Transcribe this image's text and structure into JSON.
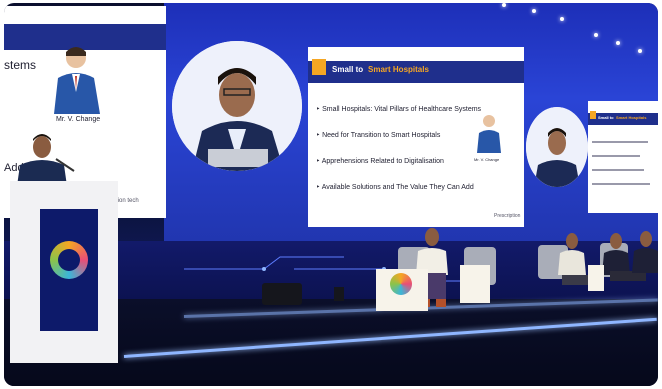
{
  "left_slide": {
    "partial_title": "stems",
    "partial_word": "Add",
    "caption": "Mr. V. Change",
    "footer_partial": "tion tech"
  },
  "main_slide": {
    "title_prefix": "Small to",
    "title_highlight": "Smart Hospitals",
    "bullets": [
      "Small Hospitals: Vital Pillars of Healthcare Systems",
      "Need for Transition to Smart Hospitals",
      "Apprehensions Related to Digitalisation",
      "Available Solutions and The Value They Can Add"
    ],
    "caption": "Mr. V. Change",
    "logo_text": "Prescription"
  },
  "right_slide": {
    "title_prefix": "Small to",
    "title_highlight": "Smart Hospitals"
  },
  "colors": {
    "stage_blue": "#2a44d6",
    "slide_band": "#1f2f8c",
    "accent_orange": "#f5a623"
  }
}
